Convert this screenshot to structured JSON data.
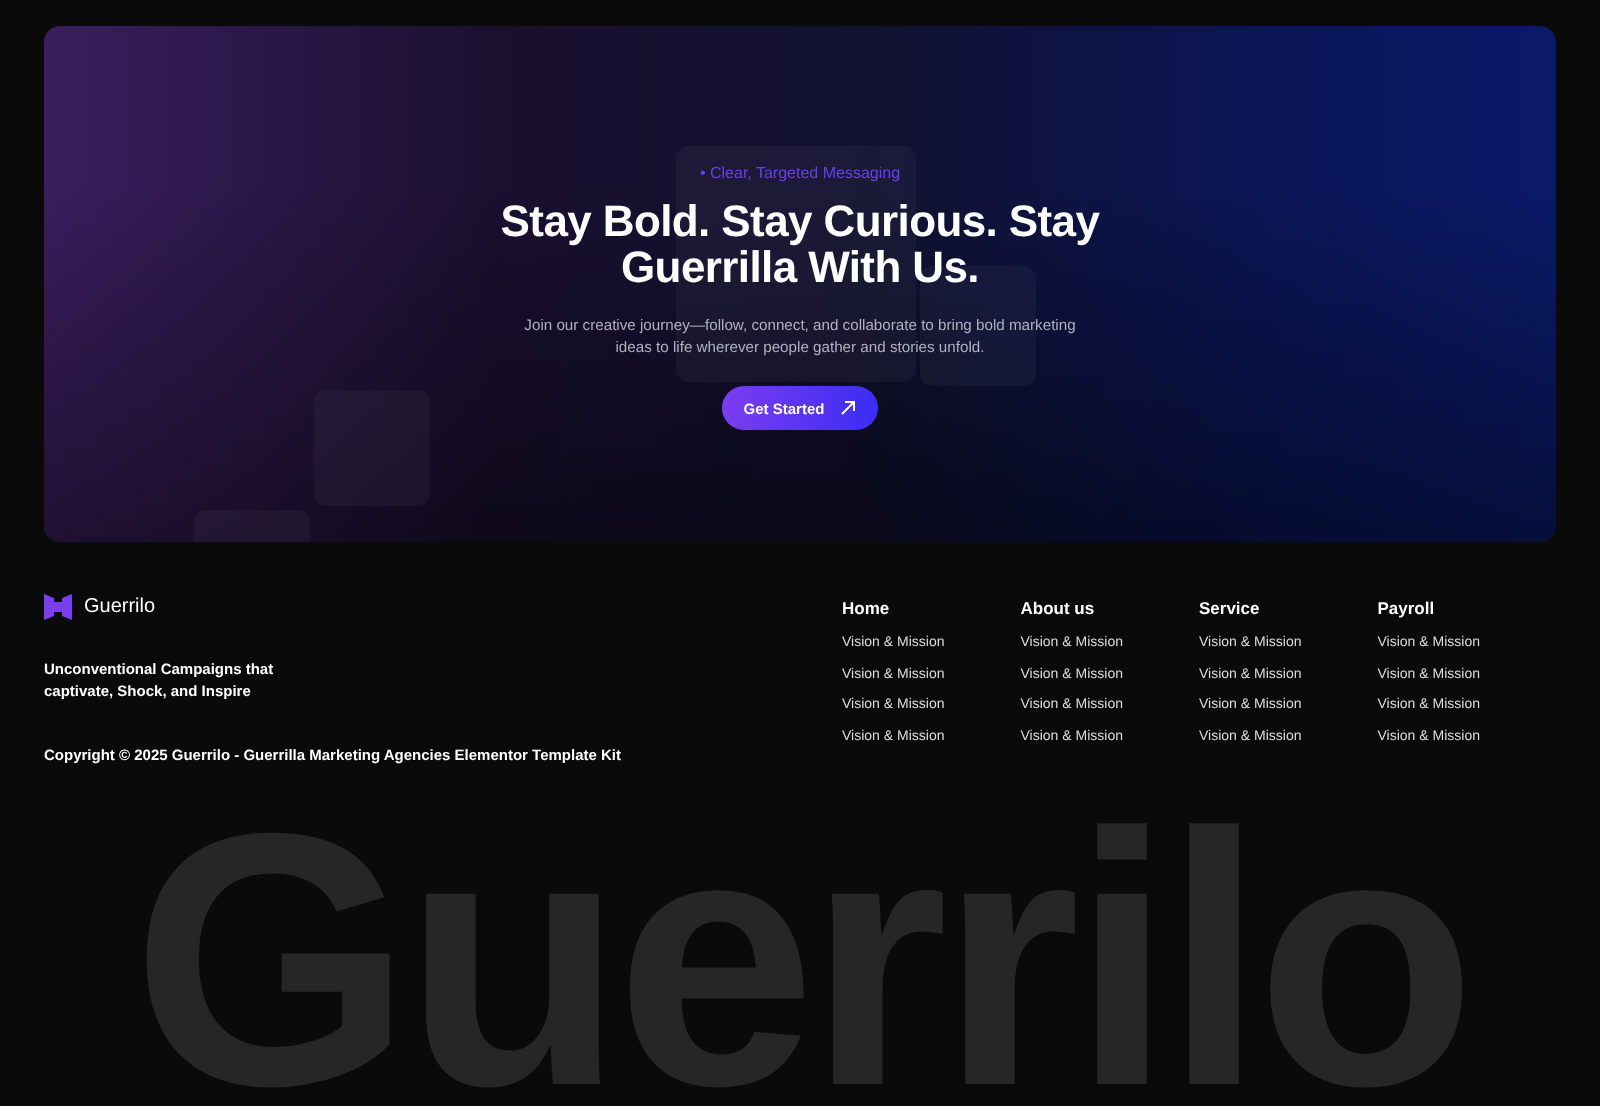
{
  "hero": {
    "tagline": "• Clear, Targeted Messaging",
    "title": "Stay Bold. Stay Curious. Stay Guerrilla With Us.",
    "description": "Join our creative journey—follow, connect, and collaborate to bring bold marketing ideas to life wherever people gather and stories unfold.",
    "button": "Get Started"
  },
  "footer": {
    "brand": "Guerrilo",
    "slogan": "Unconventional Campaigns that captivate, Shock, and Inspire",
    "copyright": "Copyright © 2025 Guerrilo - Guerrilla Marketing Agencies Elementor Template Kit",
    "columns": [
      {
        "heading": "Home",
        "links": [
          "Vision & Mission",
          "Vision & Mission",
          "Vision & Mission",
          "Vision & Mission"
        ]
      },
      {
        "heading": "About us",
        "links": [
          "Vision & Mission",
          "Vision & Mission",
          "Vision & Mission",
          "Vision & Mission"
        ]
      },
      {
        "heading": "Service",
        "links": [
          "Vision & Mission",
          "Vision & Mission",
          "Vision & Mission",
          "Vision & Mission"
        ]
      },
      {
        "heading": "Payroll",
        "links": [
          "Vision & Mission",
          "Vision & Mission",
          "Vision & Mission",
          "Vision & Mission"
        ]
      }
    ],
    "big_text": "Guerrilo"
  }
}
